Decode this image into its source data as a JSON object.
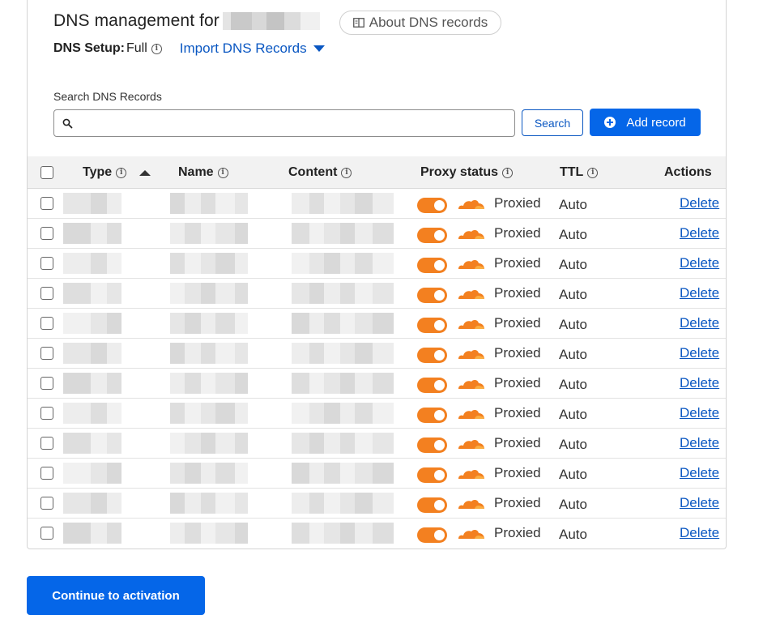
{
  "header": {
    "title": "DNS management for",
    "about_label": "About DNS records"
  },
  "setup": {
    "label": "DNS Setup:",
    "value": "Full",
    "info_glyph": "i",
    "import_label": "Import DNS Records"
  },
  "search": {
    "label": "Search DNS Records",
    "placeholder": "",
    "value": "",
    "button_label": "Search"
  },
  "add_record_label": "Add record",
  "table": {
    "columns": {
      "type": "Type",
      "name": "Name",
      "content": "Content",
      "proxy": "Proxy status",
      "ttl": "TTL",
      "actions": "Actions"
    },
    "rows": [
      {
        "proxy_on": true,
        "proxy_label": "Proxied",
        "ttl": "Auto",
        "action": "Delete"
      },
      {
        "proxy_on": true,
        "proxy_label": "Proxied",
        "ttl": "Auto",
        "action": "Delete"
      },
      {
        "proxy_on": true,
        "proxy_label": "Proxied",
        "ttl": "Auto",
        "action": "Delete"
      },
      {
        "proxy_on": true,
        "proxy_label": "Proxied",
        "ttl": "Auto",
        "action": "Delete"
      },
      {
        "proxy_on": true,
        "proxy_label": "Proxied",
        "ttl": "Auto",
        "action": "Delete"
      },
      {
        "proxy_on": true,
        "proxy_label": "Proxied",
        "ttl": "Auto",
        "action": "Delete"
      },
      {
        "proxy_on": true,
        "proxy_label": "Proxied",
        "ttl": "Auto",
        "action": "Delete"
      },
      {
        "proxy_on": true,
        "proxy_label": "Proxied",
        "ttl": "Auto",
        "action": "Delete"
      },
      {
        "proxy_on": true,
        "proxy_label": "Proxied",
        "ttl": "Auto",
        "action": "Delete"
      },
      {
        "proxy_on": true,
        "proxy_label": "Proxied",
        "ttl": "Auto",
        "action": "Delete"
      },
      {
        "proxy_on": true,
        "proxy_label": "Proxied",
        "ttl": "Auto",
        "action": "Delete"
      },
      {
        "proxy_on": true,
        "proxy_label": "Proxied",
        "ttl": "Auto",
        "action": "Delete"
      }
    ]
  },
  "continue_label": "Continue to activation",
  "colors": {
    "primary": "#0566e8",
    "link": "#0a57c2",
    "proxy_orange": "#f38020"
  },
  "icons": {
    "about": "book-icon",
    "info": "info-icon",
    "import": "caret-down-icon",
    "search": "search-icon",
    "add": "plus-circle-icon",
    "sort": "sort-ascending-icon",
    "proxy": "cloud-icon"
  }
}
